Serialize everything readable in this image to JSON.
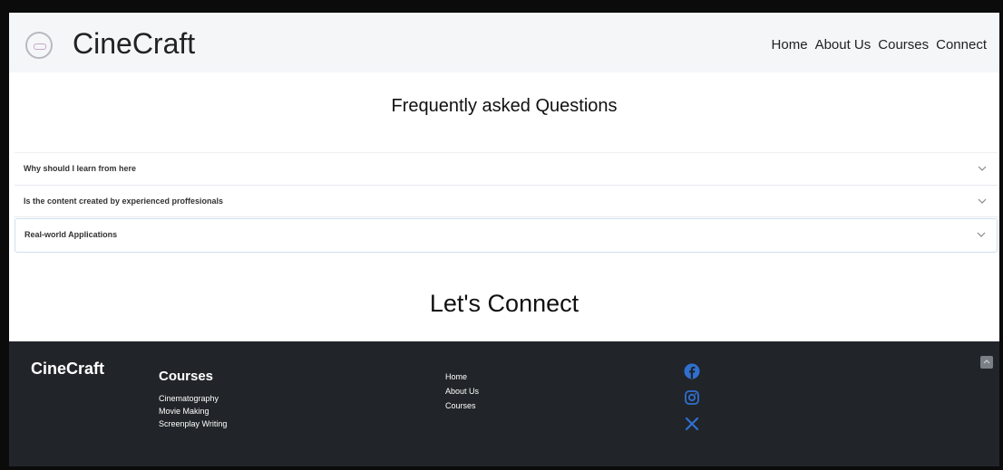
{
  "navbar": {
    "brand": "CineCraft",
    "links": [
      "Home",
      "About Us",
      "Courses",
      "Connect"
    ]
  },
  "faq": {
    "title": "Frequently asked Questions",
    "items": [
      "Why should I learn from here",
      "Is the content created by experienced proffesionals",
      "Real-world Applications"
    ]
  },
  "connect": {
    "title": "Let's Connect"
  },
  "footer": {
    "brand": "CineCraft",
    "courses_heading": "Courses",
    "courses": [
      "Cinematography",
      "Movie Making",
      "Screenplay Writing"
    ],
    "links": [
      "Home",
      "About Us",
      "Courses"
    ],
    "social_icons": [
      "facebook-icon",
      "instagram-icon",
      "x-icon"
    ]
  },
  "colors": {
    "footer_bg": "#212529",
    "navbar_bg": "#f4f6f8",
    "social_icon": "#2f6fd0"
  }
}
